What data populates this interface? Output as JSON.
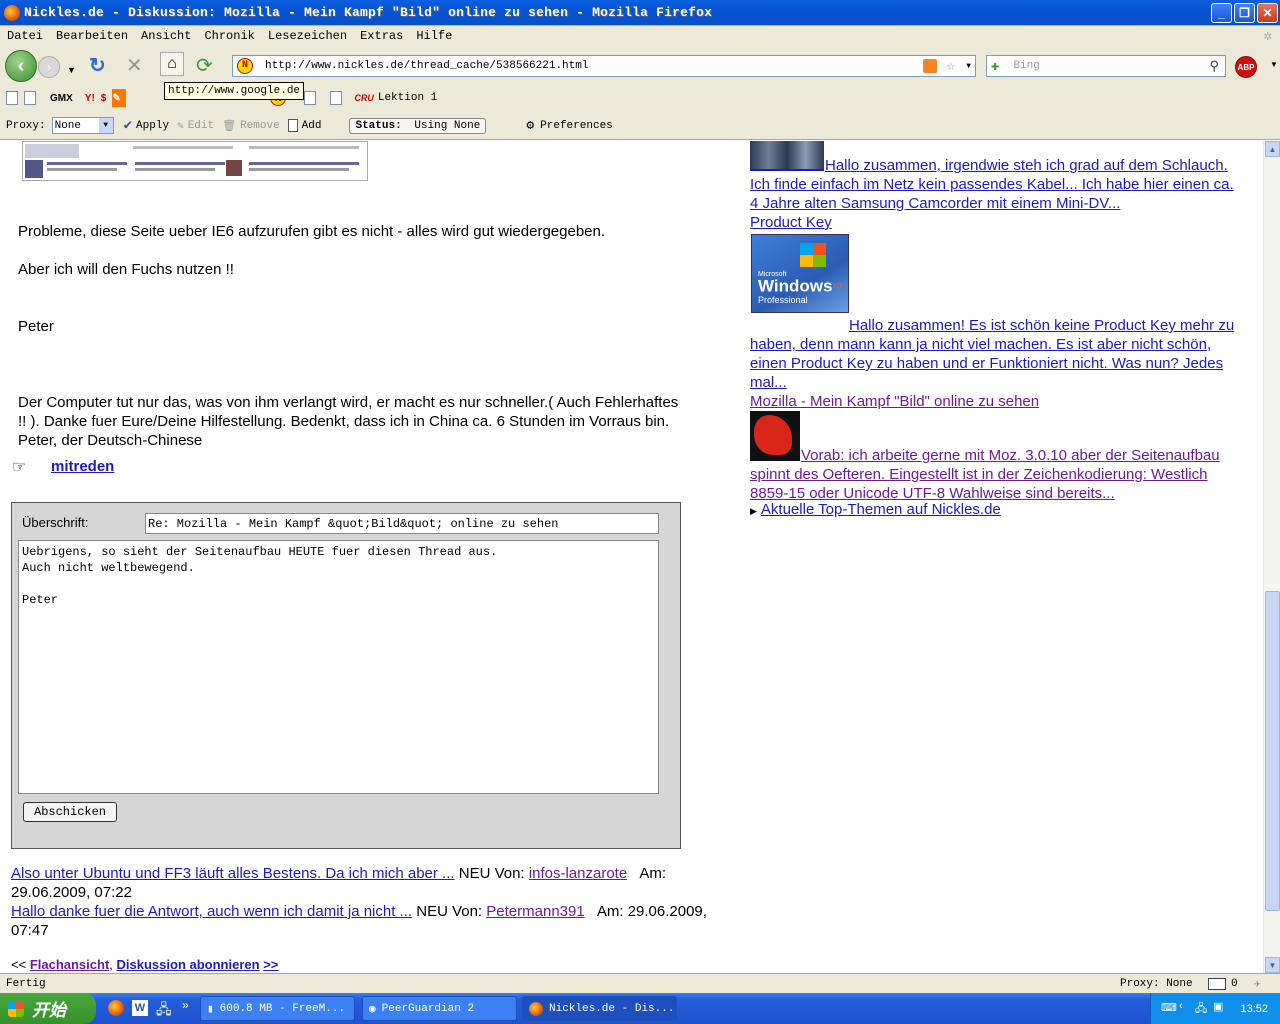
{
  "window": {
    "title": "Nickles.de - Diskussion: Mozilla - Mein Kampf \"Bild\" online zu sehen - Mozilla Firefox"
  },
  "menu": [
    "Datei",
    "Bearbeiten",
    "Ansicht",
    "Chronik",
    "Lesezeichen",
    "Extras",
    "Hilfe"
  ],
  "nav": {
    "url": "http://www.nickles.de/thread_cache/538566221.html",
    "search_placeholder": "Bing",
    "tooltip": "http://www.google.de"
  },
  "bookmarks": {
    "gmx": "GMX",
    "lektion": "Lektion 1",
    "cru": "CRU"
  },
  "proxy": {
    "label": "Proxy:",
    "value": "None",
    "apply": "Apply",
    "edit": "Edit",
    "remove": "Remove",
    "add": "Add",
    "status_label": "Status:",
    "status_value": "Using None",
    "preferences": "Preferences"
  },
  "post": {
    "line1": "Probleme, diese Seite ueber IE6 aufzurufen gibt es nicht - alles wird gut wiedergegeben.",
    "line2": "Aber ich will den Fuchs nutzen !!",
    "author": "Peter",
    "sig1": "Der Computer tut nur das, was von ihm verlangt wird, er macht es nur schneller.( Auch Fehlerhaftes",
    "sig2": "!! ). Danke fuer Eure/Deine Hilfestellung. Bedenkt, dass ich in China ca. 6 Stunden im Vorraus bin.",
    "sig3": "Peter, der Deutsch-Chinese",
    "reply_link": "mitreden"
  },
  "form": {
    "subject_label": "Überschrift:",
    "subject_value": "Re: Mozilla  -  Mein Kampf &quot;Bild&quot; online zu sehen",
    "body_value": "Uebrigens, so sieht der Seitenaufbau HEUTE fuer diesen Thread aus.\nAuch nicht weltbewegend.\n\nPeter",
    "submit": "Abschicken"
  },
  "replies": [
    {
      "title": "Also unter Ubuntu und FF3 läuft alles Bestens. Da ich mich aber ...",
      "neu": "NEU Von:",
      "user": "infos-lanzarote",
      "am": "Am:",
      "date": "29.06.2009, 07:22"
    },
    {
      "title": "Hallo danke fuer die Antwort, auch wenn ich damit ja nicht ...",
      "neu": "NEU Von:",
      "user": "Petermann391",
      "am": "Am: 29.06.2009,",
      "date": "07:47"
    }
  ],
  "footer_nav": {
    "prev": "<<",
    "flat": "Flachansicht",
    "sep": ",",
    "subscribe": "Diskussion abonnieren",
    "next": ">>"
  },
  "sidebar": {
    "item1": {
      "text1": "Hallo zusammen, irgendwie steh ich grad auf dem Schlauch.",
      "text2": "Ich finde einfach im Netz kein passendes Kabel... Ich habe hier einen ca.",
      "text3": "4 Jahre alten Samsung Camcorder mit einem Mini-DV..."
    },
    "item2": {
      "title": "Product Key",
      "img_brand": "Microsoft",
      "img_name": "Windows",
      "img_xp": "xp",
      "img_edition": "Professional",
      "text1": "Hallo zusammen! Es ist schön keine Product Key mehr zu",
      "text2": "haben, denn mann kann ja nicht viel machen. Es ist aber nicht schön,",
      "text3": "einen Product Key zu haben und er Funktioniert nicht. Was nun? Jedes",
      "text4": "mal..."
    },
    "item3": {
      "title": "Mozilla - Mein Kampf \"Bild\" online zu sehen",
      "text1": "Vorab: ich arbeite gerne mit Moz. 3.0.10 aber der Seitenaufbau",
      "text2": "spinnt des Oefteren. Eingestellt ist in der Zeichenkodierung: Westlich",
      "text3": "8859-15 oder Unicode UTF-8 Wahlweise sind bereits..."
    },
    "top_topics": "Aktuelle Top-Themen auf Nickles.de"
  },
  "statusbar": {
    "text": "Fertig",
    "proxy": "Proxy: None",
    "mail_count": "0"
  },
  "taskbar": {
    "start": "开始",
    "tasks": [
      "600.8 MB - FreeM...",
      "PeerGuardian 2",
      "Nickles.de - Dis..."
    ],
    "clock": "13:52"
  }
}
